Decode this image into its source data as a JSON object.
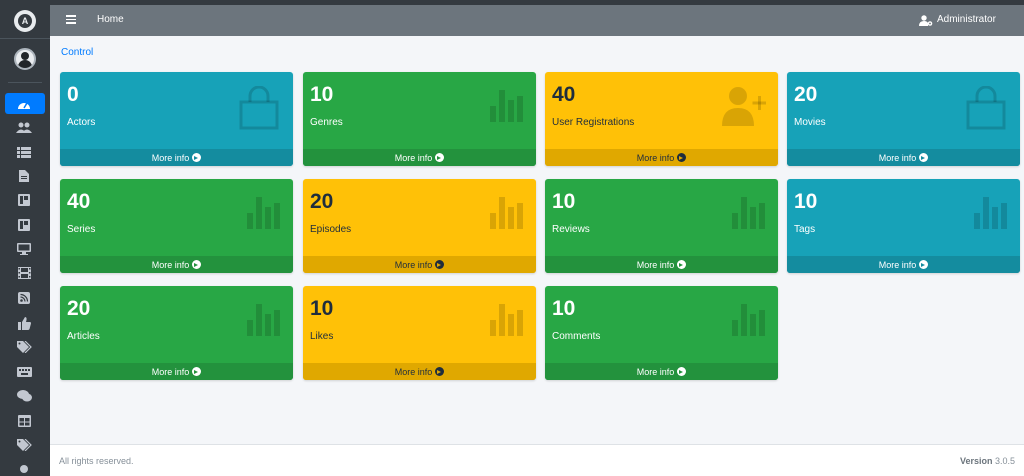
{
  "colors": {
    "teal": "#17a2b8",
    "green": "#28a745",
    "yellow": "#ffc107",
    "sidebar": "#343a40",
    "navbar": "#6c757d",
    "active": "#007bff"
  },
  "navbar": {
    "home": "Home",
    "user": "Administrator"
  },
  "breadcrumb": "Control",
  "sidebar": {
    "brand_letter": "A",
    "items": [
      {
        "icon": "dashboard-icon",
        "active": true
      },
      {
        "icon": "users-icon"
      },
      {
        "icon": "list-icon"
      },
      {
        "icon": "document-icon"
      },
      {
        "icon": "book-icon"
      },
      {
        "icon": "book-icon"
      },
      {
        "icon": "desktop-icon"
      },
      {
        "icon": "film-icon"
      },
      {
        "icon": "rss-icon"
      },
      {
        "icon": "thumbs-up-icon"
      },
      {
        "icon": "tags-icon"
      },
      {
        "icon": "keyboard-icon"
      },
      {
        "icon": "comments-icon"
      },
      {
        "icon": "table-icon"
      },
      {
        "icon": "tags-icon"
      }
    ]
  },
  "cards": [
    {
      "value": "0",
      "label": "Actors",
      "link": "More info",
      "color": "teal",
      "icon": "shopping-bag-icon"
    },
    {
      "value": "10",
      "label": "Genres",
      "link": "More info",
      "color": "green",
      "icon": "bar-chart-icon"
    },
    {
      "value": "40",
      "label": "User Registrations",
      "link": "More info",
      "color": "yellow",
      "icon": "user-plus-icon"
    },
    {
      "value": "20",
      "label": "Movies",
      "link": "More info",
      "color": "teal",
      "icon": "shopping-bag-icon"
    },
    {
      "value": "40",
      "label": "Series",
      "link": "More info",
      "color": "green",
      "icon": "bar-chart-icon"
    },
    {
      "value": "20",
      "label": "Episodes",
      "link": "More info",
      "color": "yellow",
      "icon": "bar-chart-icon"
    },
    {
      "value": "10",
      "label": "Reviews",
      "link": "More info",
      "color": "green",
      "icon": "bar-chart-icon"
    },
    {
      "value": "10",
      "label": "Tags",
      "link": "More info",
      "color": "teal",
      "icon": "bar-chart-icon"
    },
    {
      "value": "20",
      "label": "Articles",
      "link": "More info",
      "color": "green",
      "icon": "bar-chart-icon"
    },
    {
      "value": "10",
      "label": "Likes",
      "link": "More info",
      "color": "yellow",
      "icon": "bar-chart-icon"
    },
    {
      "value": "10",
      "label": "Comments",
      "link": "More info",
      "color": "green",
      "icon": "bar-chart-icon"
    }
  ],
  "footer": {
    "left": "All rights reserved.",
    "version_label": "Version",
    "version": "3.0.5"
  }
}
